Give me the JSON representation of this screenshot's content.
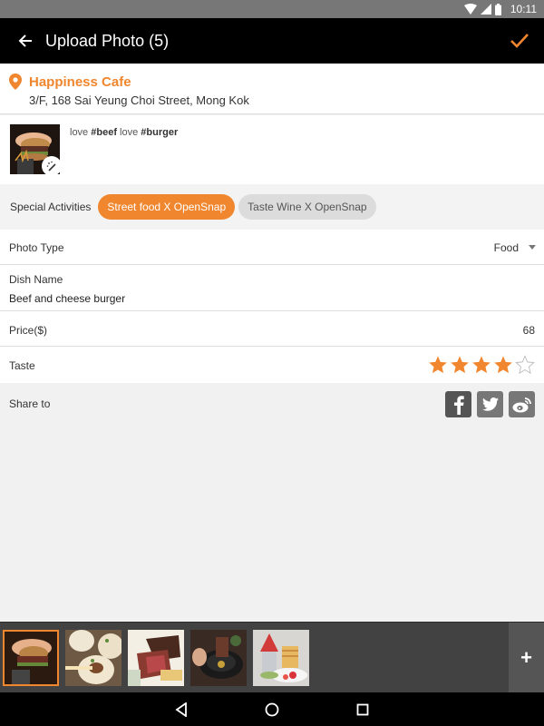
{
  "status_bar": {
    "time": "10:11",
    "icons": [
      "wifi-icon",
      "signal-icon",
      "battery-icon"
    ]
  },
  "app_bar": {
    "back_icon": "arrow-left-icon",
    "title": "Upload Photo (5)",
    "confirm_icon": "checkmark-icon"
  },
  "location": {
    "icon": "map-pin-icon",
    "name": "Happiness Cafe",
    "address": "3/F, 168 Sai Yeung Choi Street, Mong Kok"
  },
  "caption": {
    "segments": [
      {
        "text": "love ",
        "bold": false
      },
      {
        "text": "#beef",
        "bold": true
      },
      {
        "text": " love ",
        "bold": false
      },
      {
        "text": "#burger",
        "bold": true
      }
    ],
    "edit_icon": "magic-wand-icon"
  },
  "activities": {
    "label": "Special Activities",
    "chips": [
      {
        "label": "Street food X OpenSnap",
        "selected": true
      },
      {
        "label": "Taste Wine X OpenSnap",
        "selected": false
      }
    ]
  },
  "form": {
    "photo_type": {
      "label": "Photo Type",
      "value": "Food"
    },
    "dish_name": {
      "label": "Dish Name",
      "value": "Beef and cheese burger"
    },
    "price": {
      "label": "Price($)",
      "value": "68"
    },
    "taste": {
      "label": "Taste",
      "rating": 4,
      "max": 5
    }
  },
  "share": {
    "label": "Share to",
    "services": [
      "facebook",
      "twitter",
      "weibo"
    ]
  },
  "photo_strip": {
    "count": 5,
    "selected_index": 0,
    "photos": [
      "burger",
      "dumplings",
      "steak",
      "grill",
      "dessert"
    ],
    "add_label": "+"
  },
  "colors": {
    "accent": "#f0862e",
    "app_bar": "#000000",
    "status_bar": "#777777"
  }
}
